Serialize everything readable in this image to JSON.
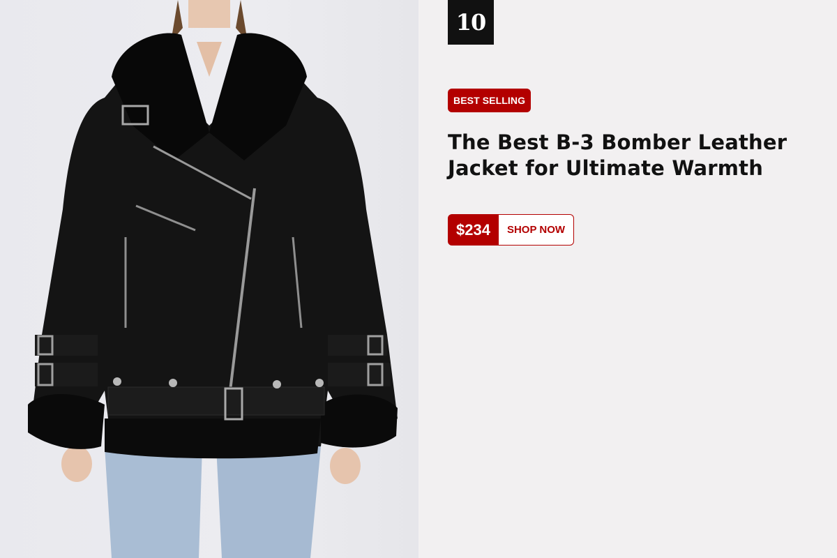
{
  "product": {
    "rank": "10",
    "badge": "BEST SELLING",
    "title": "The Best B-3 Bomber Leather Jacket for Ultimate Warmth",
    "price": "$234",
    "cta": "SHOP NOW"
  },
  "colors": {
    "accent": "#b30000",
    "rank_bg": "#111111",
    "panel_bg": "#f2f0f1"
  }
}
